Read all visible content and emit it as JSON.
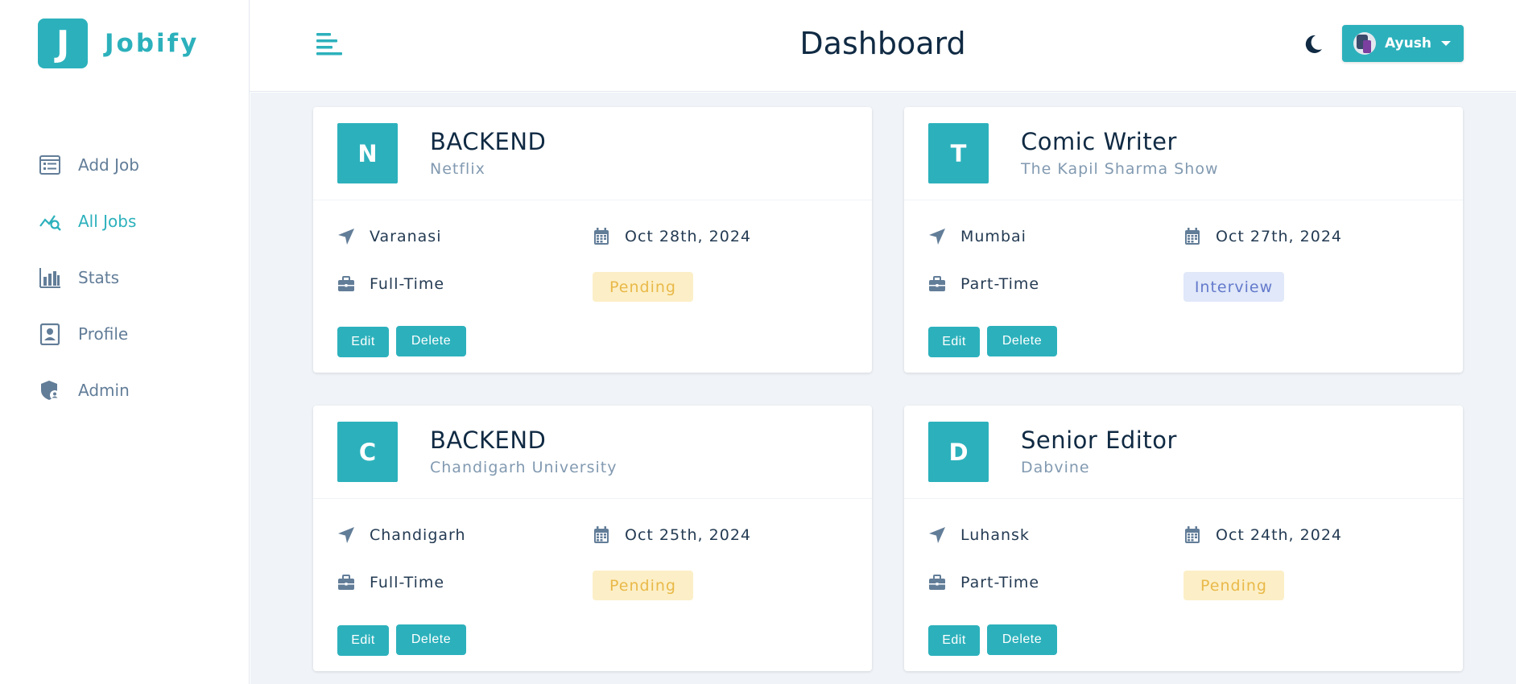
{
  "app": {
    "logo_letter": "J",
    "name": "Jobify"
  },
  "sidebar": {
    "items": [
      {
        "label": "Add Job",
        "icon": "add-job-icon"
      },
      {
        "label": "All Jobs",
        "icon": "all-jobs-icon",
        "active": true
      },
      {
        "label": "Stats",
        "icon": "stats-icon"
      },
      {
        "label": "Profile",
        "icon": "profile-icon"
      },
      {
        "label": "Admin",
        "icon": "admin-icon"
      }
    ]
  },
  "header": {
    "title": "Dashboard",
    "user_name": "Ayush"
  },
  "jobs": [
    {
      "letter": "N",
      "position": "BACKEND",
      "company": "Netflix",
      "location": "Varanasi",
      "date": "Oct 28th, 2024",
      "type": "Full-Time",
      "status": "Pending"
    },
    {
      "letter": "T",
      "position": "Comic Writer",
      "company": "The Kapil Sharma Show",
      "location": "Mumbai",
      "date": "Oct 27th, 2024",
      "type": "Part-Time",
      "status": "Interview"
    },
    {
      "letter": "C",
      "position": "BACKEND",
      "company": "Chandigarh University",
      "location": "Chandigarh",
      "date": "Oct 25th, 2024",
      "type": "Full-Time",
      "status": "Pending"
    },
    {
      "letter": "D",
      "position": "Senior Editor",
      "company": "Dabvine",
      "location": "Luhansk",
      "date": "Oct 24th, 2024",
      "type": "Part-Time",
      "status": "Pending"
    }
  ],
  "actions": {
    "edit_label": "Edit",
    "delete_label": "Delete"
  },
  "colors": {
    "primary": "#2cb1bc",
    "pending_bg": "#fcefc7",
    "pending_text": "#e9b949",
    "interview_bg": "#e0e8f9",
    "interview_text": "#647acb"
  }
}
